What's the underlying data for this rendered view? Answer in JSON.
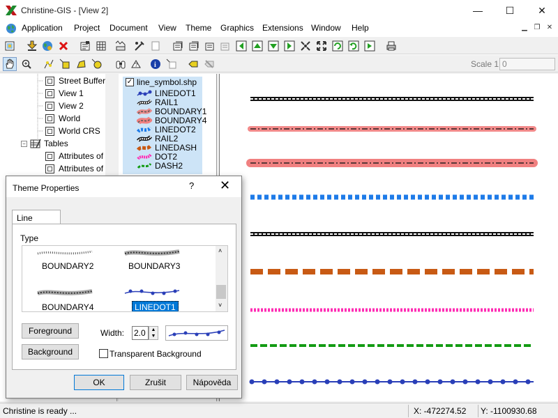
{
  "window": {
    "title": "Christine-GIS - [View 2]"
  },
  "titlebar_controls": {
    "minimize": "—",
    "maximize": "☐",
    "close": "✕"
  },
  "menu": [
    "Application",
    "Project",
    "Document",
    "View",
    "Theme",
    "Graphics",
    "Extensions",
    "Window",
    "Help"
  ],
  "doc_controls": {
    "minimize": "▁",
    "restore": "❐",
    "close": "✕"
  },
  "toolbar1_icons": [
    "new-project-icon",
    "add-theme-icon",
    "globe-icon",
    "delete-icon",
    "properties-icon",
    "table-icon",
    "layout-icon",
    "copy-icon",
    "paste-icon",
    "gear-icon",
    "zoom-extent-icon",
    "zoom-active-icon",
    "zoom-selected-icon",
    "zoom-in-icon",
    "zoom-out-icon",
    "pan-left-icon",
    "pan-up-icon",
    "pan-down-icon",
    "pan-right-icon",
    "full-extent-icon",
    "refresh-icon",
    "zoom-previous-icon",
    "zoom-next-icon",
    "print-icon"
  ],
  "toolbar2_icons": [
    "hand-icon",
    "magnify-icon",
    "select-icon",
    "select-rect-icon",
    "select-poly-icon",
    "select-circle-icon",
    "binoculars-icon",
    "query-icon",
    "info-icon",
    "measure-icon",
    "label-icon",
    "label-delete-icon"
  ],
  "scale": {
    "label": "Scale 1:",
    "value": "0"
  },
  "tree": {
    "items": [
      {
        "label": "Street Buffer",
        "kind": "view"
      },
      {
        "label": "View 1",
        "kind": "view"
      },
      {
        "label": "View 2",
        "kind": "view"
      },
      {
        "label": "World",
        "kind": "view"
      },
      {
        "label": "World CRS",
        "kind": "view"
      }
    ],
    "tables_label": "Tables",
    "tables": [
      {
        "label": "Attributes of"
      },
      {
        "label": "Attributes of"
      }
    ]
  },
  "legend": {
    "file": "line_symbol.shp",
    "items": [
      {
        "label": "LINEDOT1",
        "color": "#2a3fb8"
      },
      {
        "label": "RAIL1",
        "color": "#111111"
      },
      {
        "label": "BOUNDARY1",
        "color": "#e88a8a"
      },
      {
        "label": "BOUNDARY4",
        "color": "#f08080"
      },
      {
        "label": "LINEDOT2",
        "color": "#1e7be8"
      },
      {
        "label": "RAIL2",
        "color": "#111111"
      },
      {
        "label": "LINEDASH",
        "color": "#c85a14"
      },
      {
        "label": "DOT2",
        "color": "#ff2db4"
      },
      {
        "label": "DASH2",
        "color": "#139b13"
      }
    ]
  },
  "map_lines": [
    {
      "name": "rail-black",
      "color": "#111111"
    },
    {
      "name": "boundary1",
      "color": "#f28a8a"
    },
    {
      "name": "boundary4",
      "color": "#f08080"
    },
    {
      "name": "linedot2",
      "color": "#1e7be8"
    },
    {
      "name": "rail2",
      "color": "#111111"
    },
    {
      "name": "linedash",
      "color": "#c85a14"
    },
    {
      "name": "dot2",
      "color": "#ff2db4"
    },
    {
      "name": "dash2",
      "color": "#139b13"
    },
    {
      "name": "linedot1",
      "color": "#2a3fb8"
    }
  ],
  "dialog": {
    "title": "Theme Properties",
    "help": "?",
    "close": "✕",
    "tab": "Line Symbol",
    "type_label": "Type",
    "types": [
      {
        "label": "BOUNDARY2",
        "selected": false
      },
      {
        "label": "BOUNDARY3",
        "selected": false
      },
      {
        "label": "BOUNDARY4",
        "selected": false
      },
      {
        "label": "LINEDOT1",
        "selected": true
      }
    ],
    "foreground_button": "Foreground",
    "background_button": "Background",
    "width_label": "Width:",
    "width_value": "2.0",
    "transparent_label": "Transparent Background",
    "ok": "OK",
    "cancel": "Zrušit",
    "help_button": "Nápověda"
  },
  "status": {
    "message": "Christine is ready ...",
    "x": "X: -472274.52",
    "y": "Y: -1100930.68"
  }
}
